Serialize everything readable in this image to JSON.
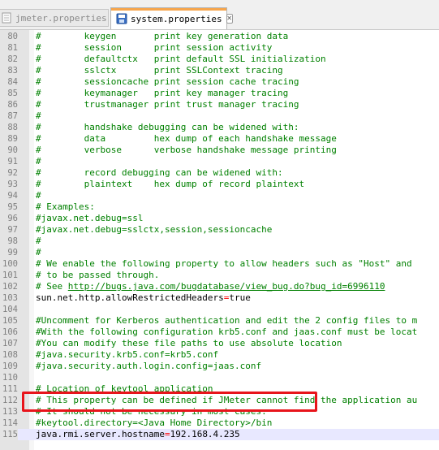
{
  "tabs": [
    {
      "label": "jmeter.properties",
      "active": false
    },
    {
      "label": "system.properties",
      "active": true
    }
  ],
  "close_glyph": "✕",
  "lines": [
    {
      "num": "80",
      "type": "comment",
      "text": "#        keygen       print key generation data"
    },
    {
      "num": "81",
      "type": "comment",
      "text": "#        session      print session activity"
    },
    {
      "num": "82",
      "type": "comment",
      "text": "#        defaultctx   print default SSL initialization"
    },
    {
      "num": "83",
      "type": "comment",
      "text": "#        sslctx       print SSLContext tracing"
    },
    {
      "num": "84",
      "type": "comment",
      "text": "#        sessioncache print session cache tracing"
    },
    {
      "num": "85",
      "type": "comment",
      "text": "#        keymanager   print key manager tracing"
    },
    {
      "num": "86",
      "type": "comment",
      "text": "#        trustmanager print trust manager tracing"
    },
    {
      "num": "87",
      "type": "comment",
      "text": "#"
    },
    {
      "num": "88",
      "type": "comment",
      "text": "#        handshake debugging can be widened with:"
    },
    {
      "num": "89",
      "type": "comment",
      "text": "#        data         hex dump of each handshake message"
    },
    {
      "num": "90",
      "type": "comment",
      "text": "#        verbose      verbose handshake message printing"
    },
    {
      "num": "91",
      "type": "comment",
      "text": "#"
    },
    {
      "num": "92",
      "type": "comment",
      "text": "#        record debugging can be widened with:"
    },
    {
      "num": "93",
      "type": "comment",
      "text": "#        plaintext    hex dump of record plaintext"
    },
    {
      "num": "94",
      "type": "comment",
      "text": "#"
    },
    {
      "num": "95",
      "type": "comment",
      "text": "# Examples:"
    },
    {
      "num": "96",
      "type": "comment",
      "text": "#javax.net.debug=ssl"
    },
    {
      "num": "97",
      "type": "comment",
      "text": "#javax.net.debug=sslctx,session,sessioncache"
    },
    {
      "num": "98",
      "type": "comment",
      "text": "#"
    },
    {
      "num": "99",
      "type": "comment",
      "text": "#"
    },
    {
      "num": "100",
      "type": "comment",
      "text": "# We enable the following property to allow headers such as \"Host\" and"
    },
    {
      "num": "101",
      "type": "comment",
      "text": "# to be passed through."
    },
    {
      "num": "102",
      "type": "comment-url",
      "prefix": "# See ",
      "url": "http://bugs.java.com/bugdatabase/view_bug.do?bug_id=6996110"
    },
    {
      "num": "103",
      "type": "property",
      "key": "sun.net.http.allowRestrictedHeaders",
      "eq": "=",
      "value": "true"
    },
    {
      "num": "104",
      "type": "empty",
      "text": ""
    },
    {
      "num": "105",
      "type": "comment",
      "text": "#Uncomment for Kerberos authentication and edit the 2 config files to m"
    },
    {
      "num": "106",
      "type": "comment",
      "text": "#With the following configuration krb5.conf and jaas.conf must be locat"
    },
    {
      "num": "107",
      "type": "comment",
      "text": "#You can modify these file paths to use absolute location"
    },
    {
      "num": "108",
      "type": "comment",
      "text": "#java.security.krb5.conf=krb5.conf"
    },
    {
      "num": "109",
      "type": "comment",
      "text": "#java.security.auth.login.config=jaas.conf"
    },
    {
      "num": "110",
      "type": "empty",
      "text": ""
    },
    {
      "num": "111",
      "type": "comment",
      "text": "# Location of keytool application"
    },
    {
      "num": "112",
      "type": "comment",
      "text": "# This property can be defined if JMeter cannot find the application au"
    },
    {
      "num": "113",
      "type": "comment",
      "text": "# It should not be necessary in most cases."
    },
    {
      "num": "114",
      "type": "comment",
      "text": "#keytool.directory=<Java Home Directory>/bin"
    },
    {
      "num": "115",
      "type": "property",
      "key": "java.rmi.server.hostname",
      "eq": "=",
      "value": "192.168.4.235",
      "current": true
    }
  ],
  "highlight_color": "#e8141b"
}
